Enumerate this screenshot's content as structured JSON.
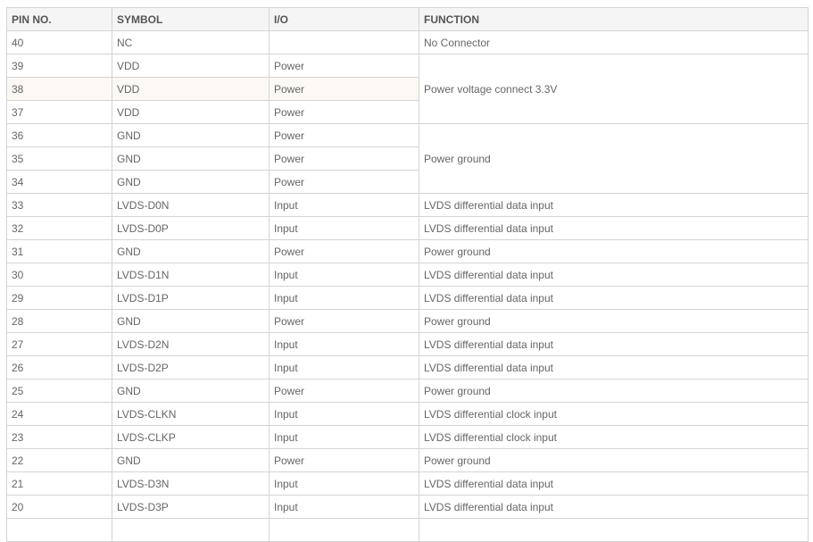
{
  "table": {
    "headers": [
      "PIN NO.",
      "SYMBOL",
      "I/O",
      "FUNCTION"
    ],
    "rows": [
      {
        "pin": "40",
        "symbol": "NC",
        "io": "",
        "function": "No Connector"
      },
      {
        "pin": "39",
        "symbol": "VDD",
        "io": "Power",
        "function": "Power voltage connect 3.3V"
      },
      {
        "pin": "38",
        "symbol": "VDD",
        "io": "Power"
      },
      {
        "pin": "37",
        "symbol": "VDD",
        "io": "Power"
      },
      {
        "pin": "36",
        "symbol": "GND",
        "io": "Power",
        "function": "Power ground"
      },
      {
        "pin": "35",
        "symbol": "GND",
        "io": "Power"
      },
      {
        "pin": "34",
        "symbol": "GND",
        "io": "Power"
      },
      {
        "pin": "33",
        "symbol": "LVDS-D0N",
        "io": "Input",
        "function": "LVDS differential data input"
      },
      {
        "pin": "32",
        "symbol": "LVDS-D0P",
        "io": "Input",
        "function": "LVDS differential data input"
      },
      {
        "pin": "31",
        "symbol": "GND",
        "io": "Power",
        "function": "Power ground"
      },
      {
        "pin": "30",
        "symbol": "LVDS-D1N",
        "io": "Input",
        "function": "LVDS differential data input"
      },
      {
        "pin": "29",
        "symbol": "LVDS-D1P",
        "io": "Input",
        "function": "LVDS differential data input"
      },
      {
        "pin": "28",
        "symbol": "GND",
        "io": "Power",
        "function": "Power ground"
      },
      {
        "pin": "27",
        "symbol": "LVDS-D2N",
        "io": "Input",
        "function": "LVDS differential data input"
      },
      {
        "pin": "26",
        "symbol": "LVDS-D2P",
        "io": "Input",
        "function": "LVDS differential data input"
      },
      {
        "pin": "25",
        "symbol": "GND",
        "io": "Power",
        "function": "Power ground"
      },
      {
        "pin": "24",
        "symbol": "LVDS-CLKN",
        "io": "Input",
        "function": "LVDS differential clock input"
      },
      {
        "pin": "23",
        "symbol": "LVDS-CLKP",
        "io": "Input",
        "function": "LVDS differential clock input"
      },
      {
        "pin": "22",
        "symbol": "GND",
        "io": "Power",
        "function": "Power ground"
      },
      {
        "pin": "21",
        "symbol": "LVDS-D3N",
        "io": "Input",
        "function": "LVDS differential data input"
      },
      {
        "pin": "20",
        "symbol": "LVDS-D3P",
        "io": "Input",
        "function": "LVDS differential data input"
      }
    ]
  },
  "colors": {
    "border": "#d4d4d4",
    "header_bg": "#f5f5f5",
    "hover_row_bg": "#fcf8f3",
    "text": "#666666"
  }
}
